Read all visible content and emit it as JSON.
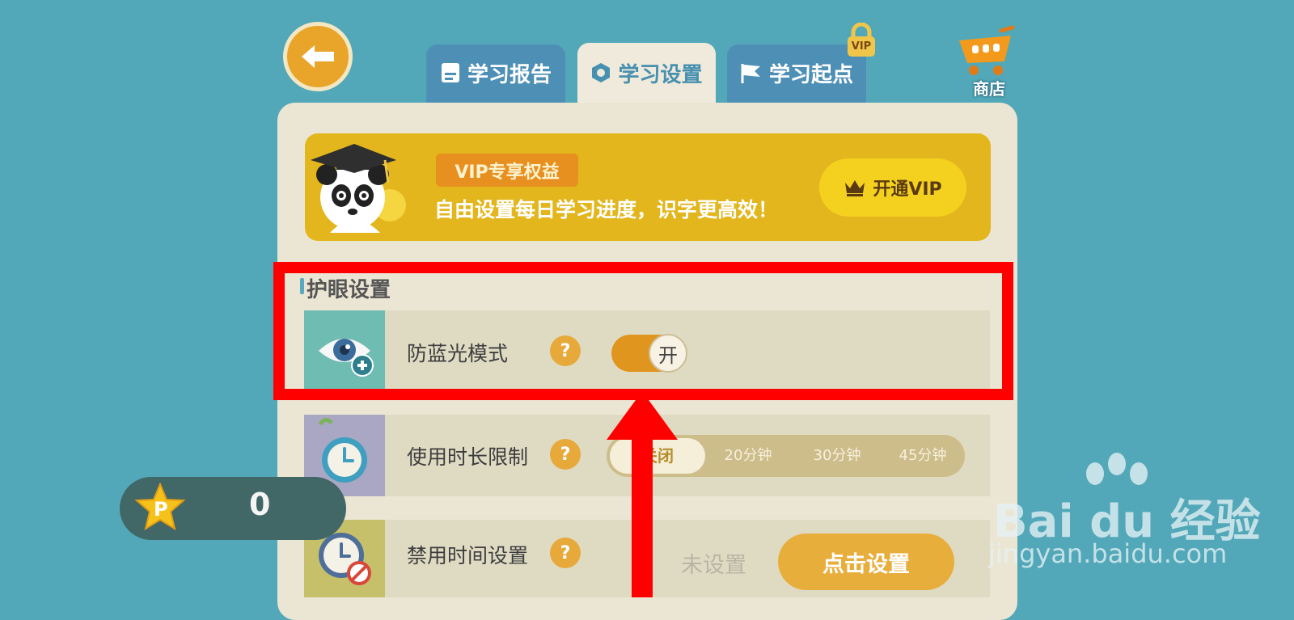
{
  "tabs": [
    {
      "label": "学习报告",
      "icon": "report-icon"
    },
    {
      "label": "学习设置",
      "icon": "hexagon-icon"
    },
    {
      "label": "学习起点",
      "icon": "flag-icon"
    }
  ],
  "vip_lock_label": "VIP",
  "shop_label": "商店",
  "banner": {
    "badge": "VIP专享权益",
    "text": "自由设置每日学习进度，识字更高效！",
    "button": "开通VIP"
  },
  "section_title": "护眼设置",
  "rows": {
    "blue_light": {
      "label": "防蓝光模式",
      "help": "?",
      "toggle": "开"
    },
    "time_limit": {
      "label": "使用时长限制",
      "help": "?",
      "options": [
        "关闭",
        "20分钟",
        "30分钟",
        "45分钟"
      ]
    },
    "ban_time": {
      "label": "禁用时间设置",
      "help": "?",
      "status": "未设置",
      "button": "点击设置"
    }
  },
  "coins": {
    "count": "0",
    "icon": "star-p-icon"
  },
  "watermark": {
    "brand": "Bai du 经验",
    "url": "jingyan.baidu.com"
  },
  "colors": {
    "background": "#52a8b8",
    "accent": "#e6a93a",
    "highlight": "#fe0000"
  }
}
